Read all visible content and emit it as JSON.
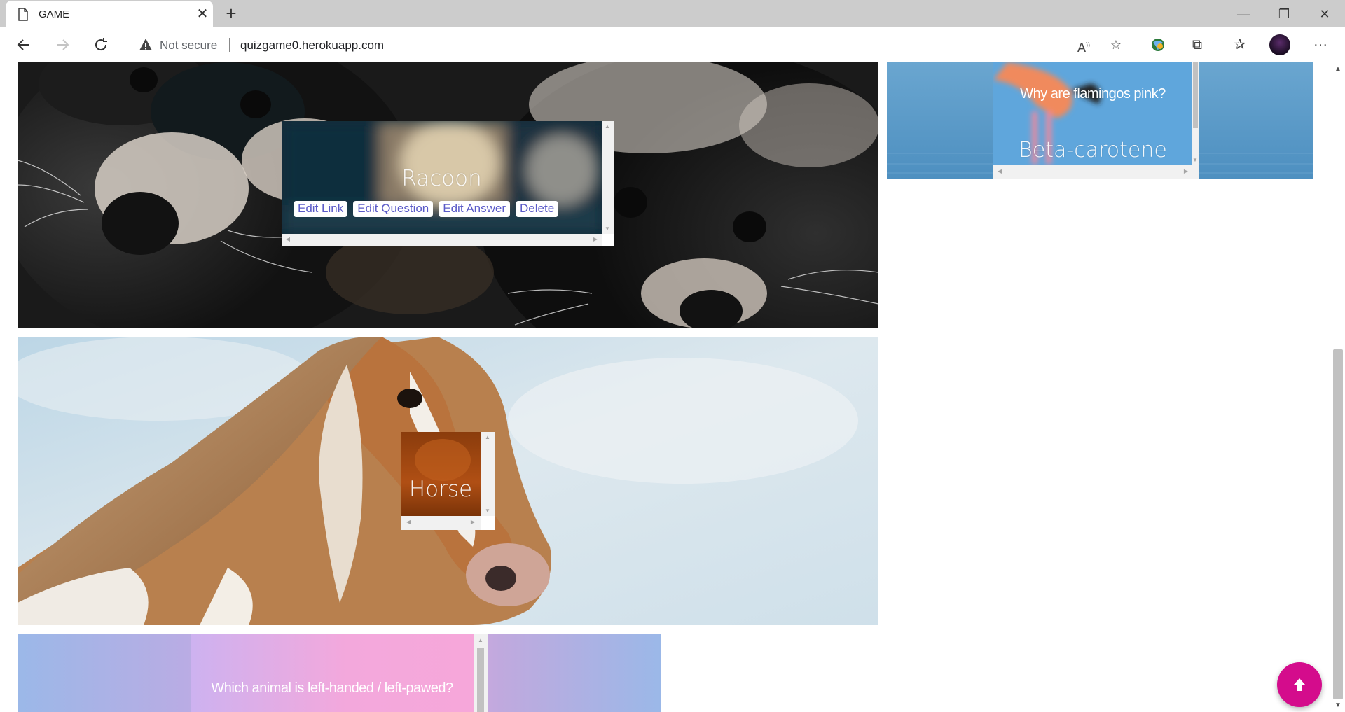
{
  "browser": {
    "tab_title": "GAME",
    "new_tab_glyph": "+",
    "security_label": "Not secure",
    "url": "quizgame0.herokuapp.com",
    "icons": [
      "page-icon",
      "close-icon",
      "plus-icon",
      "minimize-icon",
      "restore-icon",
      "close-window-icon",
      "back-arrow-icon",
      "forward-arrow-icon",
      "refresh-icon",
      "warning-icon",
      "read-aloud-icon",
      "add-favorite-icon",
      "browser-essentials-icon",
      "extensions-icon",
      "favorites-icon",
      "profile-avatar",
      "more-options-icon"
    ]
  },
  "cards": [
    {
      "name": "Racoon",
      "buttons": [
        "Edit Link",
        "Edit Question",
        "Edit Answer",
        "Delete"
      ]
    },
    {
      "name": "Horse"
    },
    {
      "question": "Why are flamingos pink?",
      "answer": "Beta-carotene"
    },
    {
      "question": "Which animal is left-handed / left-pawed?"
    }
  ],
  "colors": {
    "fab": "#d40c8c",
    "button_text": "#5b5bc8",
    "flamingo_bg": "#5fa6dc",
    "gradient_left": "#9bb8e8",
    "gradient_mid": "#f4a8dc"
  },
  "scroll_to_top_icon": "arrow-up-icon"
}
